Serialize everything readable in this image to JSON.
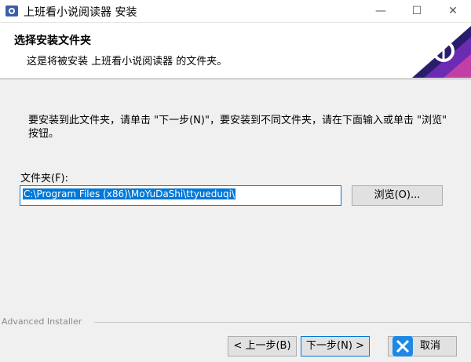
{
  "window": {
    "title": "上班看小说阅读器 安装",
    "minimize": "—",
    "maximize": "☐",
    "close": "✕"
  },
  "header": {
    "title": "选择安装文件夹",
    "subtitle": "这是将被安装 上班看小说阅读器 的文件夹。",
    "logo_colors": [
      "#2a1d6b",
      "#6b2bb3",
      "#c23fa6"
    ]
  },
  "body": {
    "instruction": "要安装到此文件夹，请单击 \"下一步(N)\"，要安装到不同文件夹，请在下面输入或单击 \"浏览\" 按钮。",
    "folder_label": "文件夹(F):",
    "folder_path": "C:\\Program Files (x86)\\MoYuDaShi\\ttyueduqi\\",
    "browse_button": "浏览(O)..."
  },
  "footer": {
    "brand": "Advanced Installer",
    "back_button": "< 上一步(B)",
    "next_button": "下一步(N) >",
    "cancel_button": "取消"
  },
  "colors": {
    "accent": "#0078d7",
    "window_bg": "#f0f0f0",
    "button_bg": "#e1e1e1"
  }
}
